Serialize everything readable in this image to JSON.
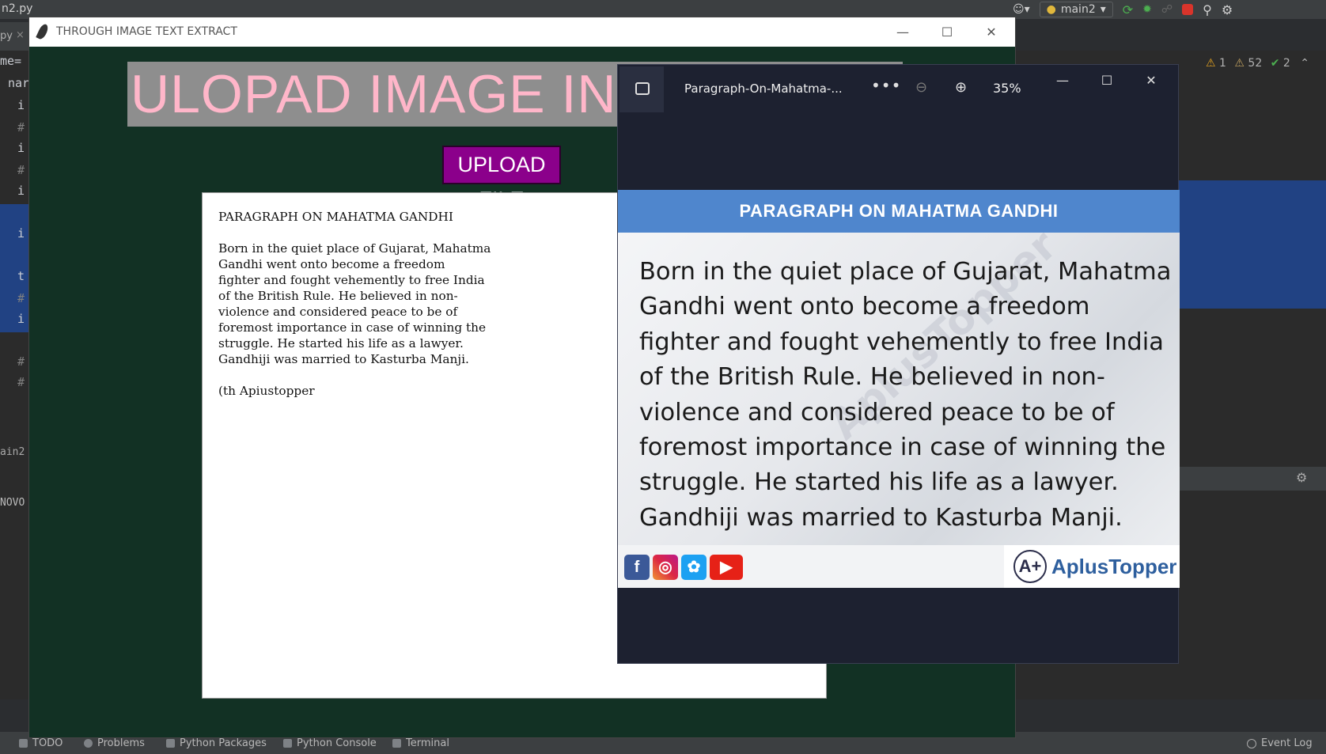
{
  "ide": {
    "filename": "n2.py",
    "tab_label": "py",
    "branch": "main2",
    "warnings_1": "1",
    "warnings_2": "52",
    "checks": "2",
    "code_lines": [
      "me=",
      "nar",
      "i",
      "#",
      "i",
      "#",
      "i",
      "i",
      "t",
      "#",
      "i",
      "#",
      "#"
    ],
    "run_label": "ain2",
    "console_text": "NOVO",
    "bottom_tabs": [
      "TODO",
      "Problems",
      "Python Packages",
      "Python Console",
      "Terminal"
    ],
    "event_log": "Event Log"
  },
  "tk_window": {
    "title": "THROUGH IMAGE TEXT EXTRACT",
    "banner": "ULOPAD IMAGE IN I",
    "upload_label": "UPLOAD FILE",
    "extracted_text": "PARAGRAPH ON MAHATMA GANDHI\n\nBorn in the quiet place of Gujarat, Mahatma\nGandhi went onto become a freedom\nfighter and fought vehemently to free India\nof the British Rule. He believed in non-\nviolence and considered peace to be of\nforemost importance in case of winning the\nstruggle. He started his life as a lawyer.\nGandhiji was married to Kasturba Manji.\n\n(th Apiustopper"
  },
  "viewer": {
    "file_title": "Paragraph-On-Mahatma-...",
    "more": "•••",
    "zoom": "35%",
    "image": {
      "header": "PARAGRAPH ON MAHATMA GANDHI",
      "body": "Born in the quiet place of Gujarat, Mahatma\nGandhi went onto become a freedom\nfighter and fought vehemently to free India\nof the British Rule. He believed in non-\nviolence and considered peace to be of\nforemost importance in case of winning the\nstruggle. He started his life as a lawyer.\nGandhiji was married to Kasturba Manji.",
      "watermark": "AplusTopper",
      "brand": "AplusTopper",
      "social": [
        "facebook-icon",
        "instagram-icon",
        "twitter-icon",
        "youtube-icon"
      ]
    }
  },
  "colors": {
    "tk_bg": "#123124",
    "banner_text": "#ffb6c9",
    "upload_bg": "#8b008b",
    "doc_header": "#4f86cd",
    "viewer_bg": "#1d2130"
  }
}
